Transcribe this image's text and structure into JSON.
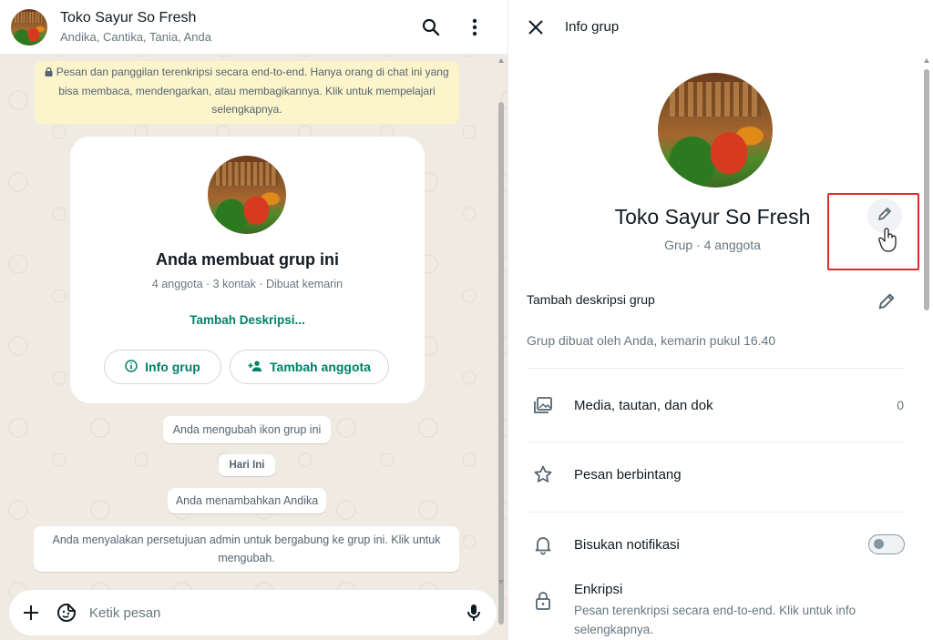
{
  "colors": {
    "accent": "#008069",
    "notice_bg": "#fcf4cb",
    "chat_bg": "#efeae2",
    "highlight": "#e02b2b"
  },
  "chat": {
    "header": {
      "title": "Toko Sayur So Fresh",
      "members": "Andika, Cantika, Tania, Anda",
      "icons": [
        "search-icon",
        "kebab-menu-icon"
      ]
    },
    "encryption_notice": "Pesan dan panggilan terenkripsi secara end-to-end. Hanya orang di chat ini yang bisa membaca, mendengarkan, atau membagikannya. Klik untuk mempelajari selengkapnya.",
    "creation_card": {
      "title": "Anda membuat grup ini",
      "meta": "4 anggota · 3 kontak · Dibuat kemarin",
      "add_description": "Tambah Deskripsi...",
      "info_button": "Info grup",
      "add_member_button": "Tambah anggota"
    },
    "system_messages": {
      "icon_changed": "Anda mengubah ikon grup ini",
      "date_divider": "Hari Ini",
      "added_member": "Anda menambahkan Andika",
      "approval": "Anda menyalakan persetujuan admin untuk bergabung ke grup ini. Klik untuk mengubah."
    },
    "composer": {
      "placeholder": "Ketik pesan",
      "icons": [
        "plus-icon",
        "sticker-icon",
        "mic-icon"
      ]
    }
  },
  "info_panel": {
    "title": "Info grup",
    "group_name": "Toko Sayur So Fresh",
    "group_meta": "Grup · 4 anggota",
    "description_label": "Tambah deskripsi grup",
    "created_note": "Grup dibuat oleh Anda, kemarin pukul 16.40",
    "media": {
      "label": "Media, tautan, dan dok",
      "count": "0"
    },
    "starred": {
      "label": "Pesan berbintang"
    },
    "mute": {
      "label": "Bisukan notifikasi",
      "enabled": false
    },
    "encryption": {
      "title": "Enkripsi",
      "description": "Pesan terenkripsi secara end-to-end. Klik untuk info selengkapnya."
    }
  }
}
